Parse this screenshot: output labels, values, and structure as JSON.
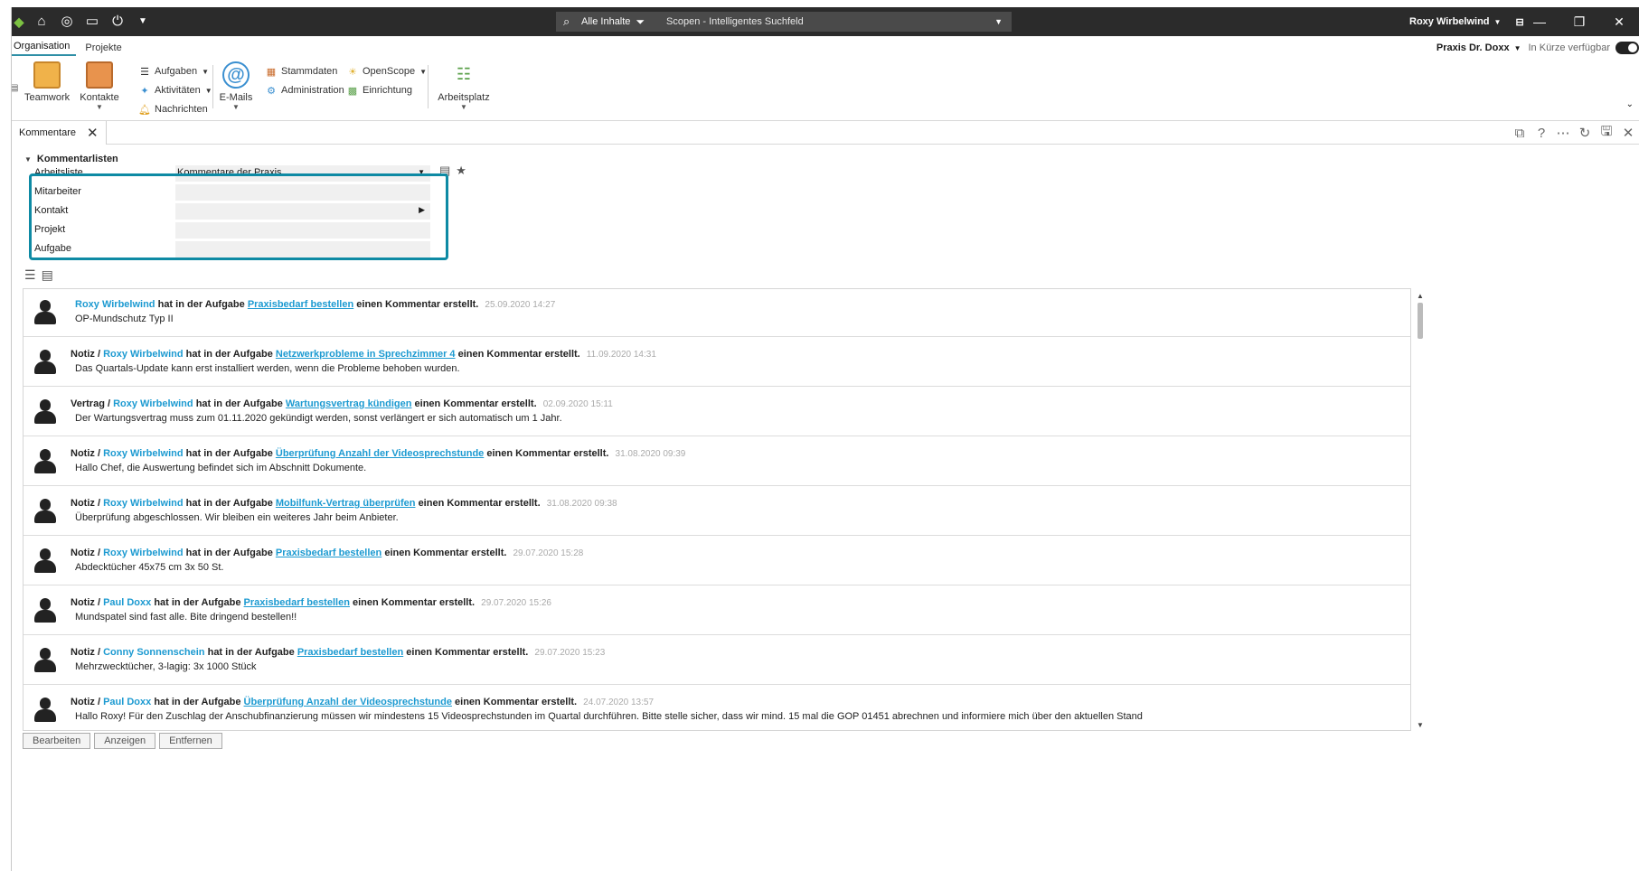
{
  "titlebar": {
    "search_scope": "Alle Inhalte",
    "search_placeholder": "Scopen - Intelligentes Suchfeld",
    "user": "Roxy Wirbelwind"
  },
  "ribbon": {
    "tabs": [
      "Organisation",
      "Projekte"
    ],
    "praxis": "Praxis Dr. Doxx",
    "availability": "In Kürze verfügbar",
    "teamwork": "Teamwork",
    "kontakte": "Kontakte",
    "aufgaben": "Aufgaben",
    "aktivitaeten": "Aktivitäten",
    "nachrichten": "Nachrichten",
    "emails": "E-Mails",
    "stammdaten": "Stammdaten",
    "administration": "Administration",
    "openscope": "OpenScope",
    "einrichtung": "Einrichtung",
    "arbeitsplatz": "Arbeitsplatz"
  },
  "doctab": {
    "label": "Kommentare"
  },
  "filters": {
    "section": "Kommentarlisten",
    "arbeitsliste_label": "Arbeitsliste",
    "arbeitsliste_value": "Kommentare der Praxis",
    "mitarbeiter_label": "Mitarbeiter",
    "kontakt_label": "Kontakt",
    "projekt_label": "Projekt",
    "aufgabe_label": "Aufgabe"
  },
  "phrases": {
    "mid": "hat in der Aufgabe",
    "end": "einen Kommentar erstellt."
  },
  "comments": [
    {
      "cat": "",
      "who": "Roxy Wirbelwind",
      "task": "Praxisbedarf bestellen",
      "ts": "25.09.2020 14:27",
      "text": "OP-Mundschutz Typ II"
    },
    {
      "cat": "Notiz /",
      "who": "Roxy Wirbelwind",
      "task": "Netzwerkprobleme in Sprechzimmer 4",
      "ts": "11.09.2020 14:31",
      "text": "Das Quartals-Update kann erst installiert werden, wenn die Probleme behoben wurden."
    },
    {
      "cat": "Vertrag /",
      "who": "Roxy Wirbelwind",
      "task": "Wartungsvertrag kündigen",
      "ts": "02.09.2020 15:11",
      "text": "Der Wartungsvertrag muss zum 01.11.2020 gekündigt werden, sonst verlängert er sich automatisch um 1 Jahr."
    },
    {
      "cat": "Notiz /",
      "who": "Roxy Wirbelwind",
      "task": "Überprüfung Anzahl der Videosprechstunde",
      "ts": "31.08.2020 09:39",
      "text": "Hallo Chef, die Auswertung befindet sich im Abschnitt Dokumente."
    },
    {
      "cat": "Notiz /",
      "who": "Roxy Wirbelwind",
      "task": "Mobilfunk-Vertrag überprüfen",
      "ts": "31.08.2020 09:38",
      "text": "Überprüfung abgeschlossen. Wir bleiben ein weiteres Jahr beim Anbieter."
    },
    {
      "cat": "Notiz /",
      "who": "Roxy Wirbelwind",
      "task": "Praxisbedarf bestellen",
      "ts": "29.07.2020 15:28",
      "text": "Abdecktücher  45x75 cm 3x 50 St."
    },
    {
      "cat": "Notiz /",
      "who": "Paul Doxx",
      "task": "Praxisbedarf bestellen",
      "ts": "29.07.2020 15:26",
      "text": "Mundspatel sind fast alle. Bite dringend bestellen!!"
    },
    {
      "cat": "Notiz /",
      "who": "Conny Sonnenschein",
      "task": "Praxisbedarf bestellen",
      "ts": "29.07.2020 15:23",
      "text": "Mehrzwecktücher, 3-lagig: 3x 1000 Stück"
    },
    {
      "cat": "Notiz /",
      "who": "Paul Doxx",
      "task": "Überprüfung Anzahl der Videosprechstunde",
      "ts": "24.07.2020 13:57",
      "text": "Hallo Roxy! Für den Zuschlag der Anschubfinanzierung müssen wir mindestens 15 Videosprechstunden im Quartal durchführen. Bitte stelle sicher, dass wir mind. 15 mal die GOP 01451 abrechnen und informiere mich über den aktuellen Stand"
    }
  ],
  "actions": {
    "edit": "Bearbeiten",
    "show": "Anzeigen",
    "remove": "Entfernen"
  }
}
